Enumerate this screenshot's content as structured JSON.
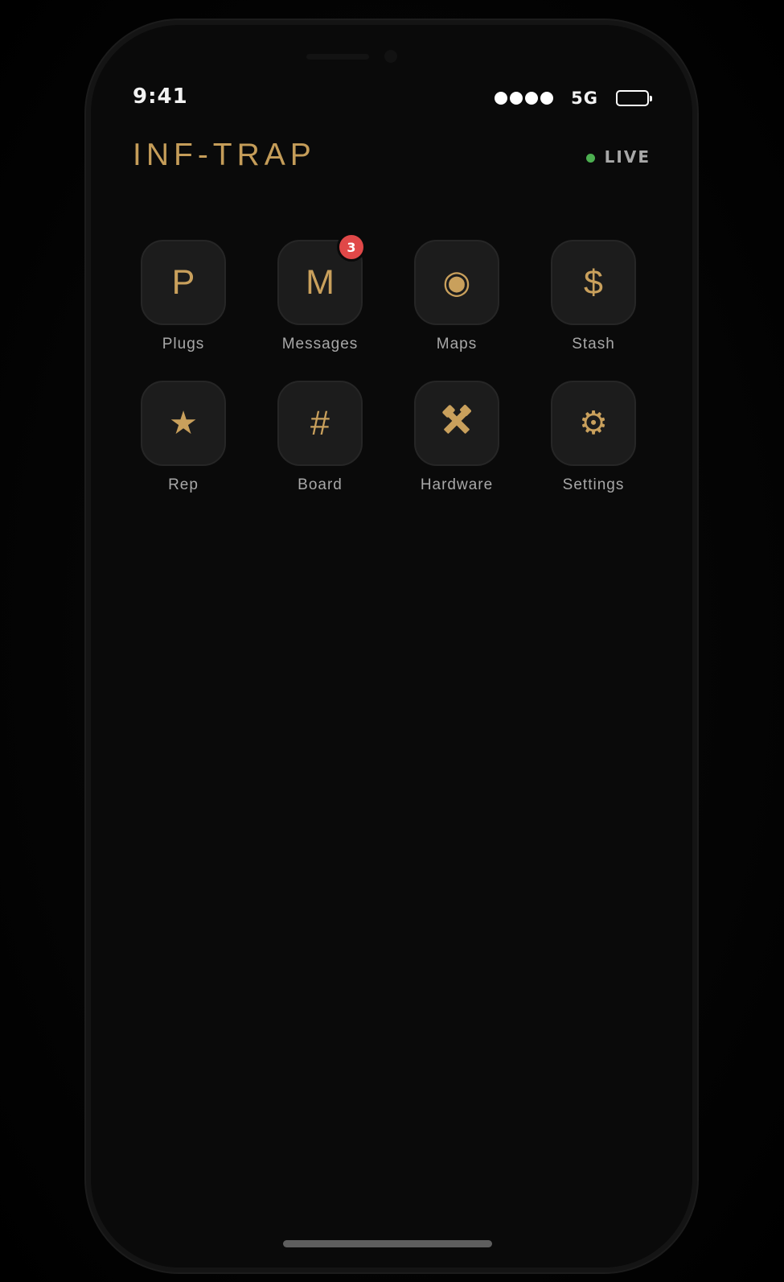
{
  "status_bar": {
    "time": "9:41",
    "network": "5G",
    "signal_bars": 4
  },
  "header": {
    "title": "INF-TRAP",
    "live_label": "LIVE"
  },
  "apps": [
    {
      "label": "Plugs",
      "glyph": "P",
      "icon": "plugs-icon"
    },
    {
      "label": "Messages",
      "glyph": "M",
      "icon": "messages-icon",
      "badge": "3"
    },
    {
      "label": "Maps",
      "glyph": "◉",
      "icon": "maps-icon"
    },
    {
      "label": "Stash",
      "glyph": "$",
      "icon": "stash-icon"
    },
    {
      "label": "Rep",
      "glyph": "★",
      "icon": "star-icon"
    },
    {
      "label": "Board",
      "glyph": "#",
      "icon": "board-icon"
    },
    {
      "label": "Hardware",
      "glyph": "🛠",
      "icon": "tools-icon"
    },
    {
      "label": "Settings",
      "glyph": "⚙",
      "icon": "gear-icon"
    }
  ],
  "colors": {
    "accent": "#c9a05c",
    "live": "#4caf50",
    "badge": "#e04848",
    "background": "#0a0a0a"
  }
}
